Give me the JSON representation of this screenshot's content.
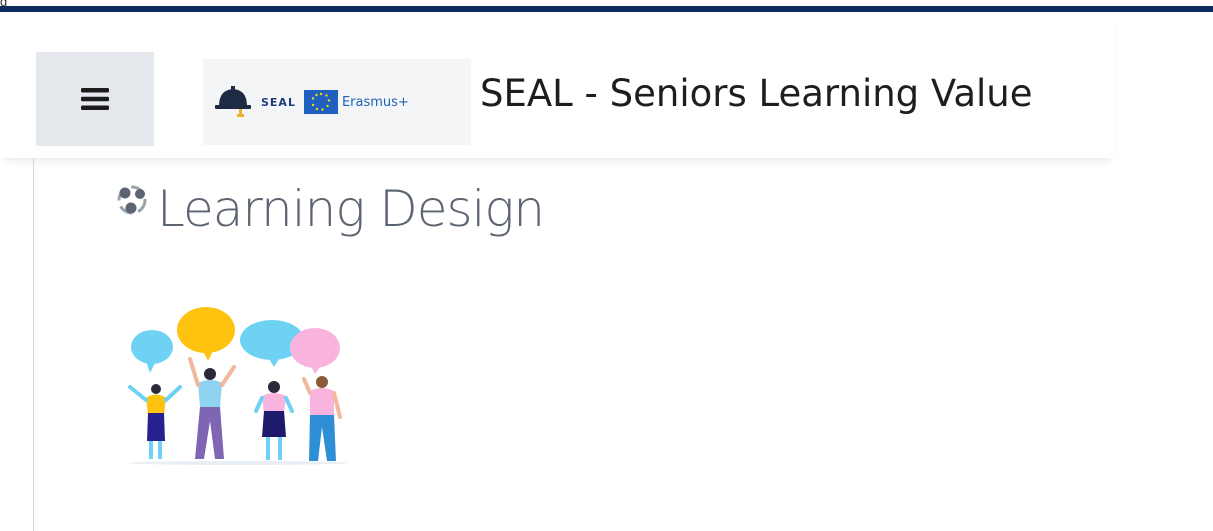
{
  "top_partial_text": "g",
  "header": {
    "menu_icon": "hamburger-menu-icon",
    "logo": {
      "seal_text": "SEAL",
      "erasmus_text": "Erasmus+",
      "eu_flag_icon": "eu-flag-icon",
      "helmet_icon": "seal-helmet-icon"
    },
    "site_title": "SEAL - Seniors Learning Value"
  },
  "main": {
    "activity_icon": "learning-design-icon",
    "page_title": "Learning Design",
    "illustration": "people-speech-bubbles-illustration"
  },
  "colors": {
    "top_bar": "#0d2c5e",
    "menu_button_bg": "#e5e8ec",
    "title_text": "#5b6470"
  }
}
